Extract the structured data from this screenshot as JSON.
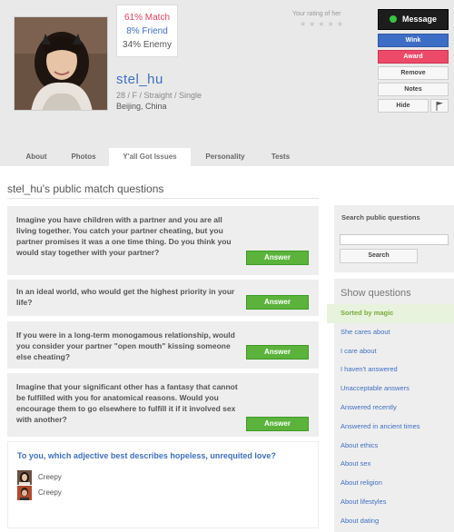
{
  "profile": {
    "match": "61% Match",
    "friend": "8% Friend",
    "enemy": "34% Enemy",
    "username": "stel_hu",
    "details": "28 / F / Straight / Single",
    "city": "Beijing, China",
    "rating_label": "Your rating of her",
    "stars": "★★★★★"
  },
  "actions": {
    "message": "Message",
    "wink": "Wink",
    "award": "Award",
    "remove": "Remove",
    "notes": "Notes",
    "hide": "Hide"
  },
  "tabs": [
    "About",
    "Photos",
    "Y'all Got Issues",
    "Personality",
    "Tests"
  ],
  "active_tab": "Y'all Got Issues",
  "main": {
    "title": "stel_hu's public match questions",
    "answer_label": "Answer",
    "questions": [
      "Imagine you have children with a partner and you are all living together. You catch your partner cheating, but you partner promises it was a one time thing. Do you think you would stay together with your partner?",
      "In an ideal world, who would get the highest priority in your life?",
      "If you were in a long-term monogamous relationship, would you consider your partner \"open mouth\" kissing someone else cheating?",
      "Imagine that your significant other has a fantasy that cannot be fulfilled with you for anatomical reasons. Would you encourage them to go elsewhere to fulfill it if it involved sex with another?"
    ],
    "featured": {
      "question": "To you, which adjective best describes hopeless, unrequited love?",
      "answers": [
        "Creepy",
        "Creepy"
      ]
    }
  },
  "sidebar": {
    "search_label": "Search public questions",
    "search_button": "Search",
    "show_title": "Show questions",
    "items": [
      "Sorted by magic",
      "She cares about",
      "I care about",
      "I haven't answered",
      "Unacceptable answers",
      "Answered recently",
      "Answered in ancient times",
      "About ethics",
      "About sex",
      "About religion",
      "About lifestyles",
      "About dating"
    ]
  },
  "colors": {
    "match": "#e8425f",
    "friend": "#3f6fc3",
    "answer_green": "#5bb33c",
    "message_black": "#1d1d1d",
    "online_green": "#37c541"
  }
}
